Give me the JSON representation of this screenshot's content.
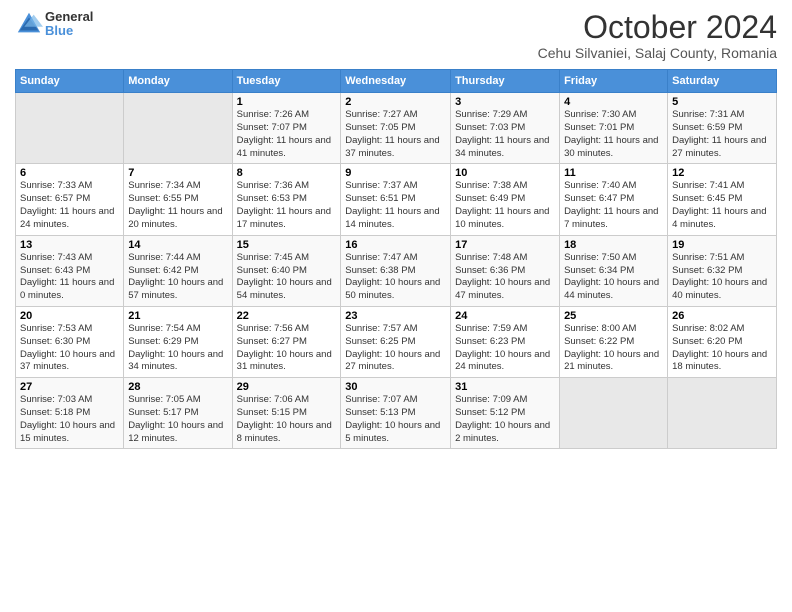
{
  "header": {
    "logo_general": "General",
    "logo_blue": "Blue",
    "month_title": "October 2024",
    "location": "Cehu Silvaniei, Salaj County, Romania"
  },
  "days_of_week": [
    "Sunday",
    "Monday",
    "Tuesday",
    "Wednesday",
    "Thursday",
    "Friday",
    "Saturday"
  ],
  "weeks": [
    [
      {
        "day": "",
        "info": ""
      },
      {
        "day": "",
        "info": ""
      },
      {
        "day": "1",
        "info": "Sunrise: 7:26 AM\nSunset: 7:07 PM\nDaylight: 11 hours and 41 minutes."
      },
      {
        "day": "2",
        "info": "Sunrise: 7:27 AM\nSunset: 7:05 PM\nDaylight: 11 hours and 37 minutes."
      },
      {
        "day": "3",
        "info": "Sunrise: 7:29 AM\nSunset: 7:03 PM\nDaylight: 11 hours and 34 minutes."
      },
      {
        "day": "4",
        "info": "Sunrise: 7:30 AM\nSunset: 7:01 PM\nDaylight: 11 hours and 30 minutes."
      },
      {
        "day": "5",
        "info": "Sunrise: 7:31 AM\nSunset: 6:59 PM\nDaylight: 11 hours and 27 minutes."
      }
    ],
    [
      {
        "day": "6",
        "info": "Sunrise: 7:33 AM\nSunset: 6:57 PM\nDaylight: 11 hours and 24 minutes."
      },
      {
        "day": "7",
        "info": "Sunrise: 7:34 AM\nSunset: 6:55 PM\nDaylight: 11 hours and 20 minutes."
      },
      {
        "day": "8",
        "info": "Sunrise: 7:36 AM\nSunset: 6:53 PM\nDaylight: 11 hours and 17 minutes."
      },
      {
        "day": "9",
        "info": "Sunrise: 7:37 AM\nSunset: 6:51 PM\nDaylight: 11 hours and 14 minutes."
      },
      {
        "day": "10",
        "info": "Sunrise: 7:38 AM\nSunset: 6:49 PM\nDaylight: 11 hours and 10 minutes."
      },
      {
        "day": "11",
        "info": "Sunrise: 7:40 AM\nSunset: 6:47 PM\nDaylight: 11 hours and 7 minutes."
      },
      {
        "day": "12",
        "info": "Sunrise: 7:41 AM\nSunset: 6:45 PM\nDaylight: 11 hours and 4 minutes."
      }
    ],
    [
      {
        "day": "13",
        "info": "Sunrise: 7:43 AM\nSunset: 6:43 PM\nDaylight: 11 hours and 0 minutes."
      },
      {
        "day": "14",
        "info": "Sunrise: 7:44 AM\nSunset: 6:42 PM\nDaylight: 10 hours and 57 minutes."
      },
      {
        "day": "15",
        "info": "Sunrise: 7:45 AM\nSunset: 6:40 PM\nDaylight: 10 hours and 54 minutes."
      },
      {
        "day": "16",
        "info": "Sunrise: 7:47 AM\nSunset: 6:38 PM\nDaylight: 10 hours and 50 minutes."
      },
      {
        "day": "17",
        "info": "Sunrise: 7:48 AM\nSunset: 6:36 PM\nDaylight: 10 hours and 47 minutes."
      },
      {
        "day": "18",
        "info": "Sunrise: 7:50 AM\nSunset: 6:34 PM\nDaylight: 10 hours and 44 minutes."
      },
      {
        "day": "19",
        "info": "Sunrise: 7:51 AM\nSunset: 6:32 PM\nDaylight: 10 hours and 40 minutes."
      }
    ],
    [
      {
        "day": "20",
        "info": "Sunrise: 7:53 AM\nSunset: 6:30 PM\nDaylight: 10 hours and 37 minutes."
      },
      {
        "day": "21",
        "info": "Sunrise: 7:54 AM\nSunset: 6:29 PM\nDaylight: 10 hours and 34 minutes."
      },
      {
        "day": "22",
        "info": "Sunrise: 7:56 AM\nSunset: 6:27 PM\nDaylight: 10 hours and 31 minutes."
      },
      {
        "day": "23",
        "info": "Sunrise: 7:57 AM\nSunset: 6:25 PM\nDaylight: 10 hours and 27 minutes."
      },
      {
        "day": "24",
        "info": "Sunrise: 7:59 AM\nSunset: 6:23 PM\nDaylight: 10 hours and 24 minutes."
      },
      {
        "day": "25",
        "info": "Sunrise: 8:00 AM\nSunset: 6:22 PM\nDaylight: 10 hours and 21 minutes."
      },
      {
        "day": "26",
        "info": "Sunrise: 8:02 AM\nSunset: 6:20 PM\nDaylight: 10 hours and 18 minutes."
      }
    ],
    [
      {
        "day": "27",
        "info": "Sunrise: 7:03 AM\nSunset: 5:18 PM\nDaylight: 10 hours and 15 minutes."
      },
      {
        "day": "28",
        "info": "Sunrise: 7:05 AM\nSunset: 5:17 PM\nDaylight: 10 hours and 12 minutes."
      },
      {
        "day": "29",
        "info": "Sunrise: 7:06 AM\nSunset: 5:15 PM\nDaylight: 10 hours and 8 minutes."
      },
      {
        "day": "30",
        "info": "Sunrise: 7:07 AM\nSunset: 5:13 PM\nDaylight: 10 hours and 5 minutes."
      },
      {
        "day": "31",
        "info": "Sunrise: 7:09 AM\nSunset: 5:12 PM\nDaylight: 10 hours and 2 minutes."
      },
      {
        "day": "",
        "info": ""
      },
      {
        "day": "",
        "info": ""
      }
    ]
  ]
}
